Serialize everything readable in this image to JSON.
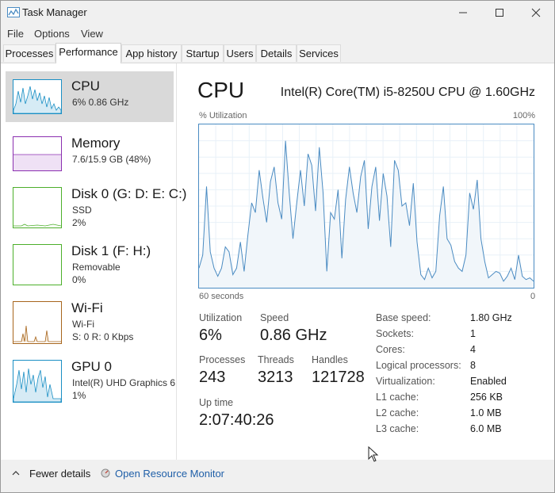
{
  "window": {
    "title": "Task Manager"
  },
  "menu": [
    "File",
    "Options",
    "View"
  ],
  "tabs": [
    "Processes",
    "Performance",
    "App history",
    "Startup",
    "Users",
    "Details",
    "Services"
  ],
  "active_tab": "Performance",
  "sidebar": [
    {
      "name": "CPU",
      "lines": [
        "6%  0.86 GHz"
      ],
      "color": "#1a8fc4"
    },
    {
      "name": "Memory",
      "lines": [
        "7.6/15.9 GB (48%)"
      ],
      "color": "#8b2fb0"
    },
    {
      "name": "Disk 0 (G: D: E: C:)",
      "lines": [
        "SSD",
        "2%"
      ],
      "color": "#4caf2a"
    },
    {
      "name": "Disk 1 (F: H:)",
      "lines": [
        "Removable",
        "0%"
      ],
      "color": "#4caf2a"
    },
    {
      "name": "Wi-Fi",
      "lines": [
        "Wi-Fi",
        "S: 0  R: 0 Kbps"
      ],
      "color": "#a7651c"
    },
    {
      "name": "GPU 0",
      "lines": [
        "Intel(R) UHD Graphics 6",
        "1%"
      ],
      "color": "#1a8fc4"
    }
  ],
  "cpu": {
    "title": "CPU",
    "model": "Intel(R) Core(TM) i5-8250U CPU @ 1.60GHz",
    "graph_label": "% Utilization",
    "graph_max": "100%",
    "time_left": "60 seconds",
    "time_right": "0",
    "utilization_label": "Utilization",
    "utilization": "6%",
    "speed_label": "Speed",
    "speed": "0.86 GHz",
    "processes_label": "Processes",
    "processes": "243",
    "threads_label": "Threads",
    "threads": "3213",
    "handles_label": "Handles",
    "handles": "121728",
    "uptime_label": "Up time",
    "uptime": "2:07:40:26",
    "specs": [
      {
        "label": "Base speed:",
        "value": "1.80 GHz"
      },
      {
        "label": "Sockets:",
        "value": "1"
      },
      {
        "label": "Cores:",
        "value": "4"
      },
      {
        "label": "Logical processors:",
        "value": "8"
      },
      {
        "label": "Virtualization:",
        "value": "Enabled"
      },
      {
        "label": "L1 cache:",
        "value": "256 KB"
      },
      {
        "label": "L2 cache:",
        "value": "1.0 MB"
      },
      {
        "label": "L3 cache:",
        "value": "6.0 MB"
      }
    ],
    "utilization_history": [
      12,
      20,
      62,
      22,
      12,
      7,
      12,
      25,
      22,
      8,
      12,
      28,
      10,
      32,
      52,
      46,
      72,
      55,
      40,
      65,
      74,
      52,
      42,
      90,
      58,
      30,
      52,
      72,
      50,
      82,
      75,
      47,
      86,
      58,
      10,
      46,
      42,
      60,
      18,
      54,
      74,
      58,
      46,
      68,
      78,
      36,
      62,
      74,
      41,
      70,
      56,
      25,
      78,
      72,
      50,
      52,
      38,
      64,
      28,
      8,
      5,
      12,
      6,
      10,
      44,
      62,
      30,
      26,
      16,
      12,
      10,
      20,
      58,
      48,
      66,
      30,
      16,
      6,
      8,
      10,
      9,
      4,
      7,
      12,
      5,
      20,
      7,
      5,
      6,
      4
    ]
  },
  "footer": {
    "fewer": "Fewer details",
    "resource_monitor": "Open Resource Monitor"
  }
}
